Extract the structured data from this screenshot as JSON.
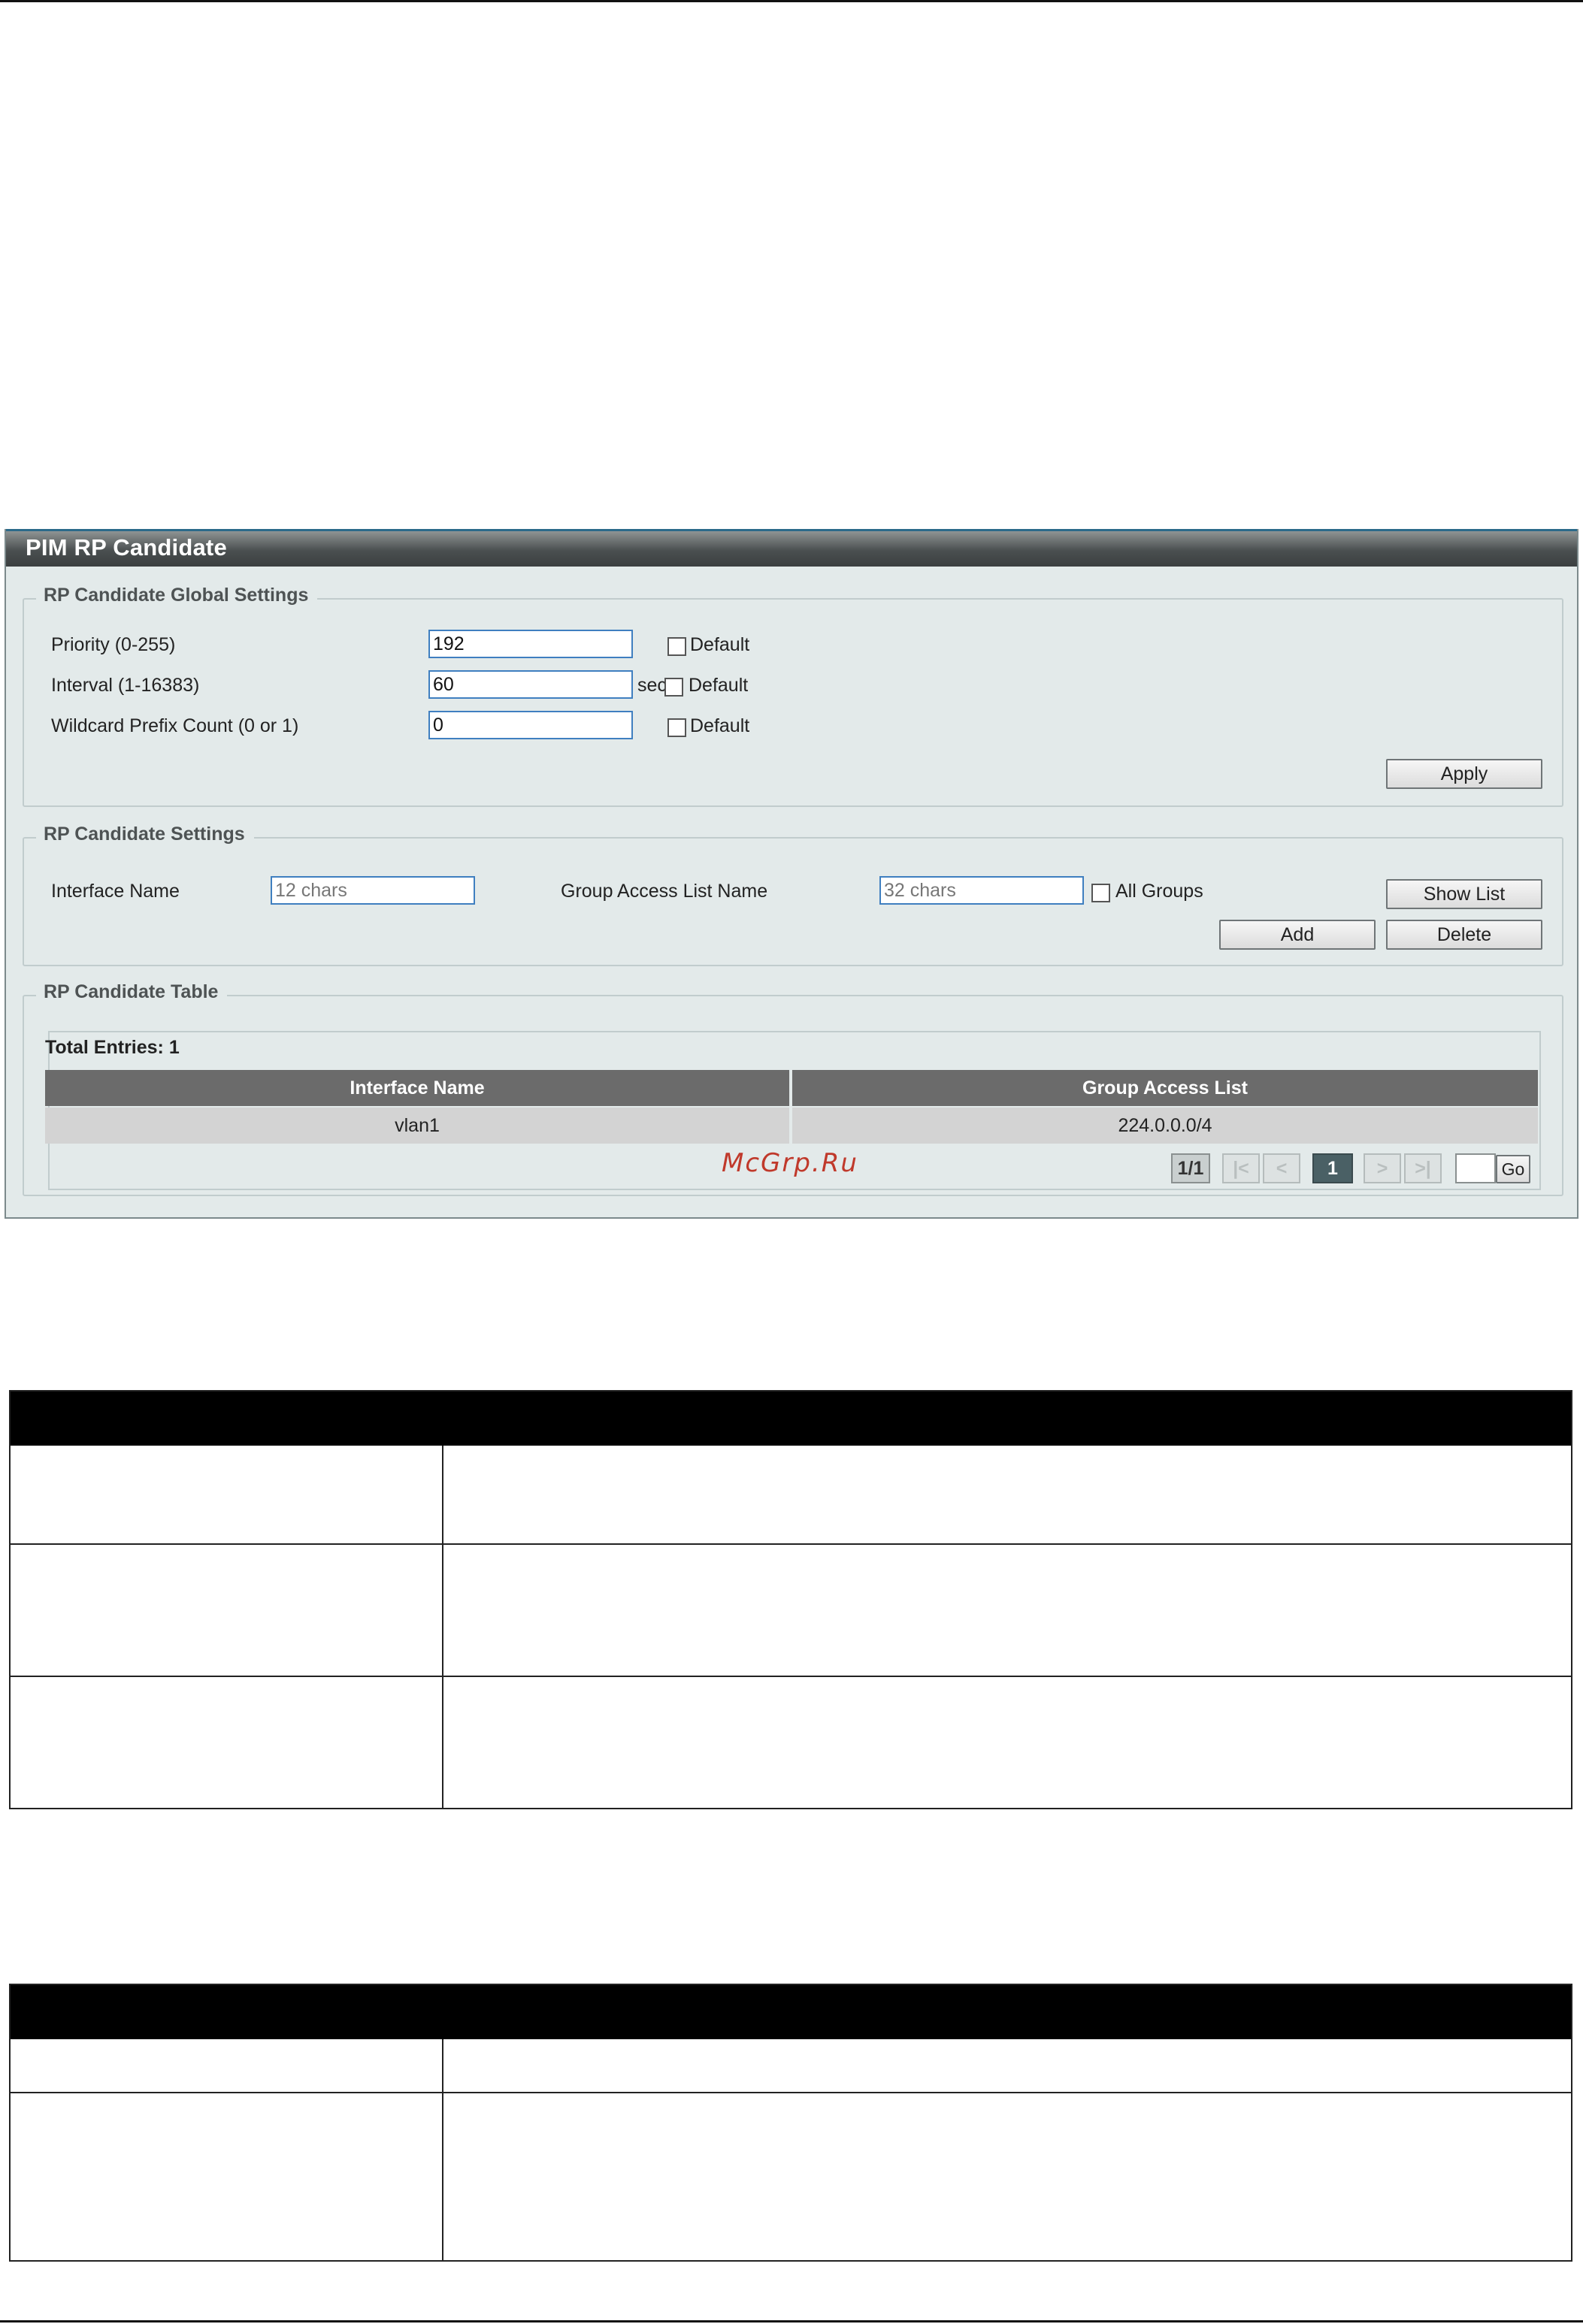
{
  "panel": {
    "title": "PIM RP Candidate",
    "global_settings": {
      "legend": "RP Candidate Global Settings",
      "priority": {
        "label": "Priority (0-255)",
        "value": "192",
        "default_label": "Default"
      },
      "interval": {
        "label": "Interval (1-16383)",
        "value": "60",
        "unit": "sec",
        "default_label": "Default"
      },
      "wildcard": {
        "label": "Wildcard Prefix Count (0 or 1)",
        "value": "0",
        "default_label": "Default"
      },
      "apply_label": "Apply"
    },
    "candidate_settings": {
      "legend": "RP Candidate Settings",
      "interface_name": {
        "label": "Interface Name",
        "placeholder": "12 chars"
      },
      "group_access_list": {
        "label": "Group Access List Name",
        "placeholder": "32 chars"
      },
      "all_groups_label": "All Groups",
      "show_list_label": "Show List",
      "add_label": "Add",
      "delete_label": "Delete"
    },
    "candidate_table": {
      "legend": "RP Candidate Table",
      "total_entries": "Total Entries: 1",
      "columns": [
        "Interface Name",
        "Group Access List"
      ],
      "rows": [
        {
          "interface": "vlan1",
          "group": "224.0.0.0/4"
        }
      ],
      "pagination": {
        "page_info": "1/1",
        "first": "|<",
        "prev": "<",
        "current": "1",
        "next": ">",
        "last": ">|",
        "go_label": "Go"
      }
    }
  },
  "watermark": "McGrp.Ru"
}
